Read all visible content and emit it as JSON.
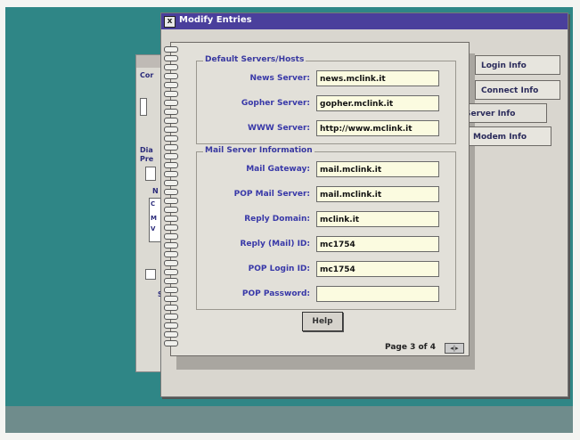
{
  "window": {
    "title": "Modify Entries",
    "sysmenu_glyph": "x"
  },
  "background_window": {
    "fragments": [
      "Cor",
      "Dia",
      "Pre",
      "N",
      "C",
      "M",
      "V",
      "S"
    ]
  },
  "notebook": {
    "groups": [
      {
        "label": "Default Servers/Hosts",
        "fields": [
          {
            "label": "News Server:",
            "value": "news.mclink.it"
          },
          {
            "label": "Gopher Server:",
            "value": "gopher.mclink.it"
          },
          {
            "label": "WWW Server:",
            "value": "http://www.mclink.it"
          }
        ]
      },
      {
        "label": "Mail Server Information",
        "fields": [
          {
            "label": "Mail Gateway:",
            "value": "mail.mclink.it"
          },
          {
            "label": "POP Mail Server:",
            "value": "mail.mclink.it"
          },
          {
            "label": "Reply Domain:",
            "value": "mclink.it"
          },
          {
            "label": "Reply (Mail) ID:",
            "value": "mc1754"
          },
          {
            "label": "POP Login ID:",
            "value": "mc1754"
          },
          {
            "label": "POP Password:",
            "value": ""
          }
        ]
      }
    ],
    "help_label": "Help",
    "page_indicator": "Page 3 of 4",
    "page_arrows": "◂|▸"
  },
  "tabs": [
    {
      "label": "Login Info",
      "active": false
    },
    {
      "label": "Connect Info",
      "active": false
    },
    {
      "label": "Server Info",
      "active": true
    },
    {
      "label": "Modem Info",
      "active": false
    }
  ],
  "colors": {
    "desktop": "#2f8686",
    "titlebar": "#4a3f9c",
    "label_text": "#3838a8",
    "field_bg": "#fbfbe0"
  }
}
